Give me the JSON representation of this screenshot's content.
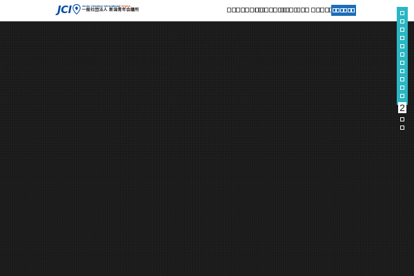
{
  "header": {
    "logo": {
      "mark": "JCI",
      "tagline_en_prefix": "Junior Chamber International",
      "tagline_en_city": "Niigata",
      "org_name_ja": "一般社団法人 新潟青年会議所"
    },
    "nav": [
      {
        "label": "□□□□□□□□"
      },
      {
        "label": "□□□□□□□"
      },
      {
        "label": "□□□□"
      },
      {
        "label": "□□□"
      },
      {
        "label": "□□□□□"
      }
    ],
    "cta_label": "□□□□□□",
    "colors": {
      "brand": "#0c4da2",
      "accent": "#e8632b",
      "cta": "#1d6fb8"
    }
  },
  "hero": {
    "background": "#1b1b1b"
  },
  "side_tab": {
    "label_before": "□□□□□□□□□□□",
    "number": "2",
    "label_after": "□□",
    "color": "#2ab7c3"
  }
}
